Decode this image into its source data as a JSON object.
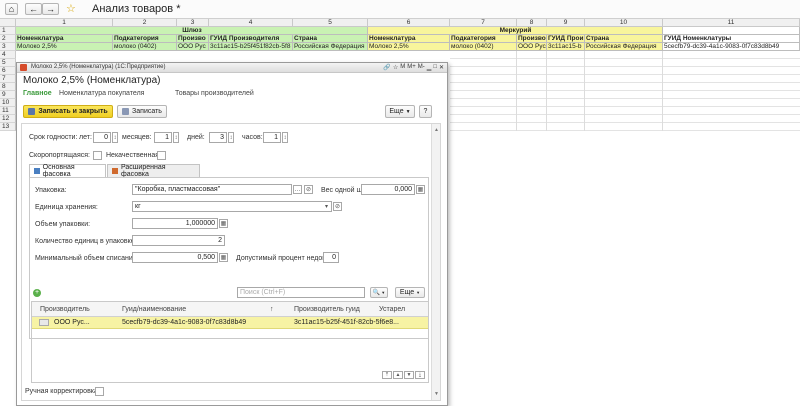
{
  "app": {
    "title": "Анализ товаров *",
    "nav_home": "⌂",
    "nav_back": "←",
    "nav_forward": "→",
    "star": "☆"
  },
  "sheet": {
    "col_numbers": [
      "1",
      "2",
      "3",
      "4",
      "5",
      "6",
      "7",
      "8",
      "9",
      "10",
      "11"
    ],
    "row_numbers": [
      "1",
      "2",
      "3",
      "4",
      "5",
      "6",
      "7",
      "8",
      "9",
      "10",
      "11",
      "12",
      "13"
    ],
    "group_gateway": "Шлюз",
    "group_mercury": "Меркурий",
    "headers": [
      "Номенклатура",
      "Подкатегория",
      "Производитель",
      "ГУИД Производителя",
      "Страна",
      "Номенклатура",
      "Подкатегория",
      "Производитель",
      "ГУИД Производителя",
      "Страна",
      "ГУИД Номенклатуры"
    ],
    "headers_short": [
      "Номенклатура",
      "Подкатегория",
      "Произво",
      "ГУИД Производителя",
      "Страна",
      "Номенклатура",
      "Подкатегория",
      "Произво",
      "ГУИД Прои",
      "Страна",
      "ГУИД Номенклатуры"
    ],
    "row3": [
      "Молоко 2,5%",
      "молоко (0402)",
      "ООО Рус",
      "3c11ac15-b25f451f82cb-5f8",
      "Российская Федерация",
      "Молоко 2,5%",
      "молоко (0402)",
      "ООО Рус",
      "3c11ac15-b",
      "Российская Федерация",
      "5cecfb79-dc39-4a1c-9083-0f7c83d8b49"
    ]
  },
  "dialog": {
    "window_title": "Молоко 2,5% (Номенклатура)  (1С:Предприятие)",
    "title": "Молоко 2,5% (Номенклатура)",
    "tabs": [
      "Главное",
      "Номенклатура покупателя",
      "Товары производителей"
    ],
    "save_close": "Записать и закрыть",
    "save": "Записать",
    "more": "Еще",
    "help": "?",
    "shelf_life_label": "Срок годности:",
    "years_label": "лет:",
    "years_value": "0",
    "months_label": "месяцев:",
    "months_value": "1",
    "days_label": "дней:",
    "days_value": "3",
    "hours_label": "часов:",
    "hours_value": "1",
    "perishable_label": "Скоропортящаяся:",
    "substandard_label": "Некачественная:",
    "subtab_main": "Основная фасовка",
    "subtab_extended": "Расширенная фасовка",
    "packaging_label": "Упаковка:",
    "packaging_value": "\"Коробка, пластмассовая\"",
    "weight_one_label": "Вес одной шт:",
    "weight_one_value": "0,000",
    "unit_label": "Единица хранения:",
    "unit_value": "кг",
    "volume_label": "Объем упаковки:",
    "volume_value": "1,000000",
    "units_in_pack_label": "Количество единиц в упаковке:",
    "units_in_pack_value": "2",
    "min_writeoff_label": "Минимальный объем списания:",
    "min_writeoff_value": "0,500",
    "shortage_label": "Допустимый процент недовеса:",
    "shortage_value": "0",
    "search_placeholder": "Поиск (Ctrl+F)",
    "table_more": "Еще",
    "table_headers": [
      "Производитель",
      "Гуид/наименование",
      "↑",
      "Производитель гуид",
      "Устарел"
    ],
    "table_row": [
      "ООО Рус...",
      "5cecfb79-dc39-4a1c-9083-0f7c83d8b49",
      "3c11ac15-b25f-451f-82cb-5f6e8..."
    ],
    "manual_label": "Ручная корректировка:"
  },
  "colors": {
    "green": "#c9f2b3",
    "yellow": "#f8f59c",
    "selected_row": "#f7f3a4",
    "save_btn": "#f5de3b"
  }
}
